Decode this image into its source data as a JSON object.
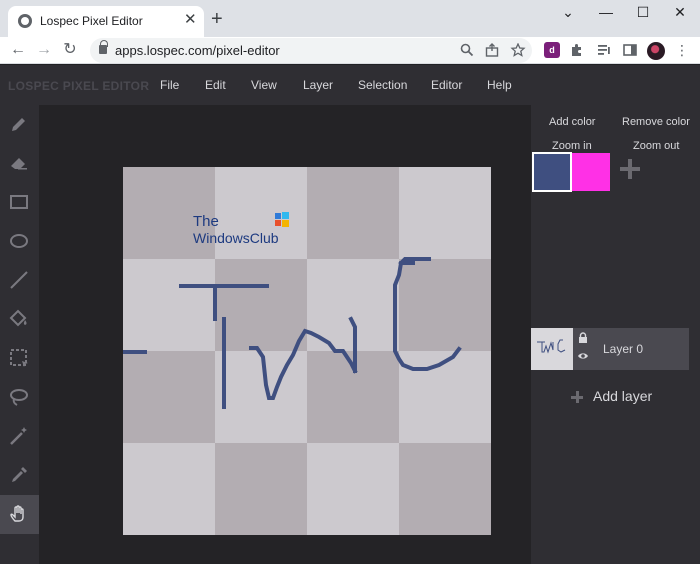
{
  "browser": {
    "tab_title": "Lospec Pixel Editor",
    "tab_close": "✕",
    "new_tab": "+",
    "url": "apps.lospec.com/pixel-editor",
    "nav": {
      "back": "←",
      "forward": "→",
      "reload": "↻"
    },
    "window_controls": {
      "dropdown": "⌄",
      "minimize": "—",
      "maximize": "☐",
      "close": "✕"
    },
    "extensions": [
      "lospec-extension-icon",
      "puzzle-icon",
      "media-queue-icon",
      "sidepanel-icon"
    ]
  },
  "app": {
    "brand": "LOSPEC PIXEL EDITOR",
    "menu": [
      "File",
      "Edit",
      "View",
      "Layer",
      "Selection",
      "Editor",
      "Help"
    ],
    "tools": [
      "pencil",
      "eraser",
      "rectangle",
      "ellipse",
      "line",
      "fill",
      "rectangle-select",
      "lasso-select",
      "magic-wand",
      "eyedropper",
      "pan"
    ],
    "active_tool": "pan",
    "palette": {
      "add_color": "Add color",
      "remove_color": "Remove color",
      "zoom_in": "Zoom in",
      "zoom_out": "Zoom out",
      "colors": [
        "#3f4f80",
        "#ff30e6"
      ],
      "selected_index": 0
    },
    "layers": [
      {
        "name": "Layer 0",
        "locked": false,
        "visible": true
      }
    ],
    "add_layer": "Add layer",
    "canvas": {
      "watermark_line1": "The",
      "watermark_line2": "WindowsClub",
      "drawn_text": "TwC",
      "stroke_color": "#3f4f80",
      "checker_light": "#ccc9ce",
      "checker_dark": "#b3adb2"
    }
  }
}
